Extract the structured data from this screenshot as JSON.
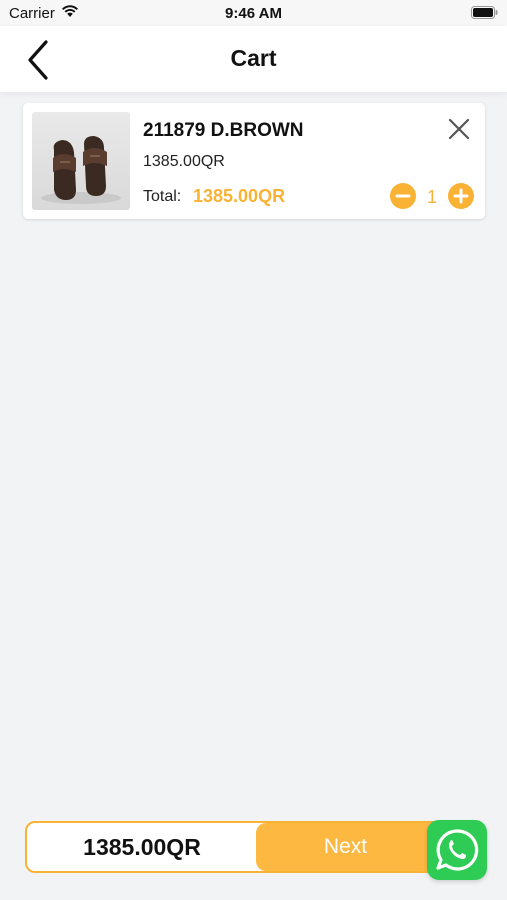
{
  "status_bar": {
    "carrier": "Carrier",
    "time": "9:46 AM"
  },
  "header": {
    "title": "Cart",
    "back_icon": "chevron-left-icon"
  },
  "cart": {
    "items": [
      {
        "name": "211879 D.BROWN",
        "price": "1385.00QR",
        "total_label": "Total:",
        "total_value": "1385.00QR",
        "quantity": "1",
        "image": "brown-sandals-photo"
      }
    ]
  },
  "footer": {
    "total": "1385.00QR",
    "next_label": "Next",
    "whatsapp_icon": "whatsapp-icon"
  },
  "colors": {
    "accent": "#f9b233",
    "whatsapp": "#2fcc55",
    "background": "#f2f3f5"
  }
}
